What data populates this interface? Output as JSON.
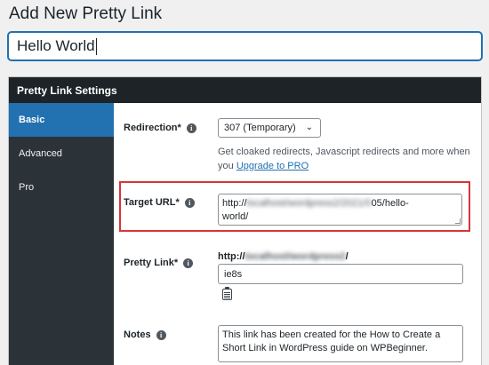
{
  "page": {
    "title": "Add New Pretty Link"
  },
  "title_input": {
    "value": "Hello World"
  },
  "panel": {
    "header": "Pretty Link Settings"
  },
  "tabs": [
    {
      "label": "Basic",
      "active": true
    },
    {
      "label": "Advanced",
      "active": false
    },
    {
      "label": "Pro",
      "active": false
    }
  ],
  "redirection": {
    "label": "Redirection*",
    "selected": "307 (Temporary)",
    "help_text": "Get cloaked redirects, Javascript redirects and more when you",
    "help_link": "Upgrade to PRO"
  },
  "target_url": {
    "label": "Target URL*",
    "value_start": "http://",
    "value_blurred": "localhost/wordpress2/2021/0",
    "value_end": "05/hello-",
    "value_line2": "world/"
  },
  "pretty_link": {
    "label": "Pretty Link*",
    "prefix_start": "http://",
    "prefix_blurred": "localhost/wordpress2",
    "prefix_end": "/",
    "slug": "ie8s"
  },
  "notes": {
    "label": "Notes",
    "value_line1": "This link has been created for the How to Create a",
    "value_line2": "Short Link in WordPress guide on WPBeginner."
  },
  "icons": [
    "info-icon",
    "chevron-down-icon",
    "copy-icon",
    "resize-handle-icon"
  ],
  "colors": {
    "accent": "#2271b1",
    "highlight": "#d63638",
    "header": "#1d2327",
    "sidebar": "#2c3338"
  }
}
